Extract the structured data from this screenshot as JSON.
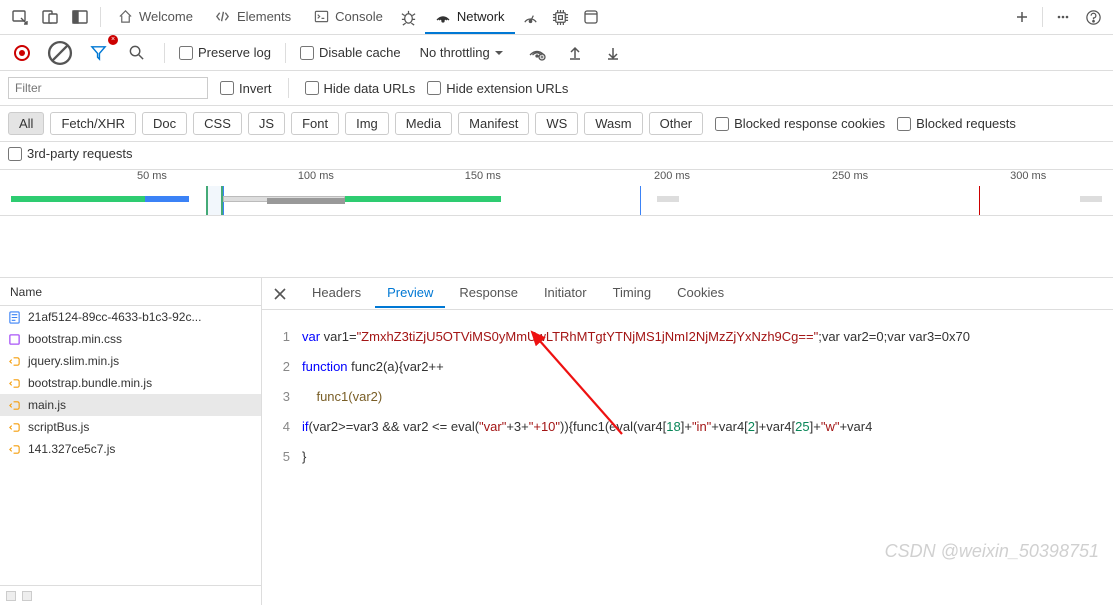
{
  "tabs": {
    "welcome": "Welcome",
    "elements": "Elements",
    "console": "Console",
    "network": "Network"
  },
  "toolbar": {
    "preserve_log": "Preserve log",
    "disable_cache": "Disable cache",
    "throttling": "No throttling"
  },
  "filter": {
    "placeholder": "Filter",
    "invert": "Invert",
    "hide_data_urls": "Hide data URLs",
    "hide_ext_urls": "Hide extension URLs",
    "pills": {
      "all": "All",
      "fetchxhr": "Fetch/XHR",
      "doc": "Doc",
      "css": "CSS",
      "js": "JS",
      "font": "Font",
      "img": "Img",
      "media": "Media",
      "manifest": "Manifest",
      "ws": "WS",
      "wasm": "Wasm",
      "other": "Other"
    },
    "blocked_cookies": "Blocked response cookies",
    "blocked_requests": "Blocked requests",
    "third_party": "3rd-party requests"
  },
  "timeline": {
    "t50": "50 ms",
    "t100": "100 ms",
    "t150": "150 ms",
    "t200": "200 ms",
    "t250": "250 ms",
    "t300": "300 ms"
  },
  "requests_header": "Name",
  "requests": [
    {
      "name": "21af5124-89cc-4633-b1c3-92c...",
      "type": "doc"
    },
    {
      "name": "bootstrap.min.css",
      "type": "css"
    },
    {
      "name": "jquery.slim.min.js",
      "type": "js"
    },
    {
      "name": "bootstrap.bundle.min.js",
      "type": "js"
    },
    {
      "name": "main.js",
      "type": "js"
    },
    {
      "name": "scriptBus.js",
      "type": "js"
    },
    {
      "name": "141.327ce5c7.js",
      "type": "js"
    }
  ],
  "detail_tabs": {
    "headers": "Headers",
    "preview": "Preview",
    "response": "Response",
    "initiator": "Initiator",
    "timing": "Timing",
    "cookies": "Cookies"
  },
  "code": {
    "kw_var": "var",
    "kw_function": "function",
    "kw_if": "if",
    "id_var1": " var1=",
    "str1": "\"ZmxhZ3tiZjU5OTViMS0yMmUwLTRhMTgtYTNjMS1jNmI2NjMzZjYxNzh9Cg==\"",
    "tail1": ";var var2=0;var var3=0x70",
    "sig": " func2(a){var2++",
    "body3": "func1(var2)",
    "cond_a": "(var2>=var3 && var2 <= eval(",
    "cond_str": "\"var\"",
    "cond_b": "+3+",
    "cond_str2": "\"+10\"",
    "cond_c": ")){func1(eval(var4[",
    "n18": "18",
    "cond_d": "]+",
    "s_in": "\"in\"",
    "cond_e": "+var4[",
    "n2": "2",
    "cond_f": "]+var4[",
    "n25": "25",
    "cond_g": "]+",
    "s_w": "\"w\"",
    "cond_h": "+var4",
    "brace": "}",
    "ln1": "1",
    "ln2": "2",
    "ln3": "3",
    "ln4": "4",
    "ln5": "5"
  },
  "watermark": "CSDN @weixin_50398751"
}
